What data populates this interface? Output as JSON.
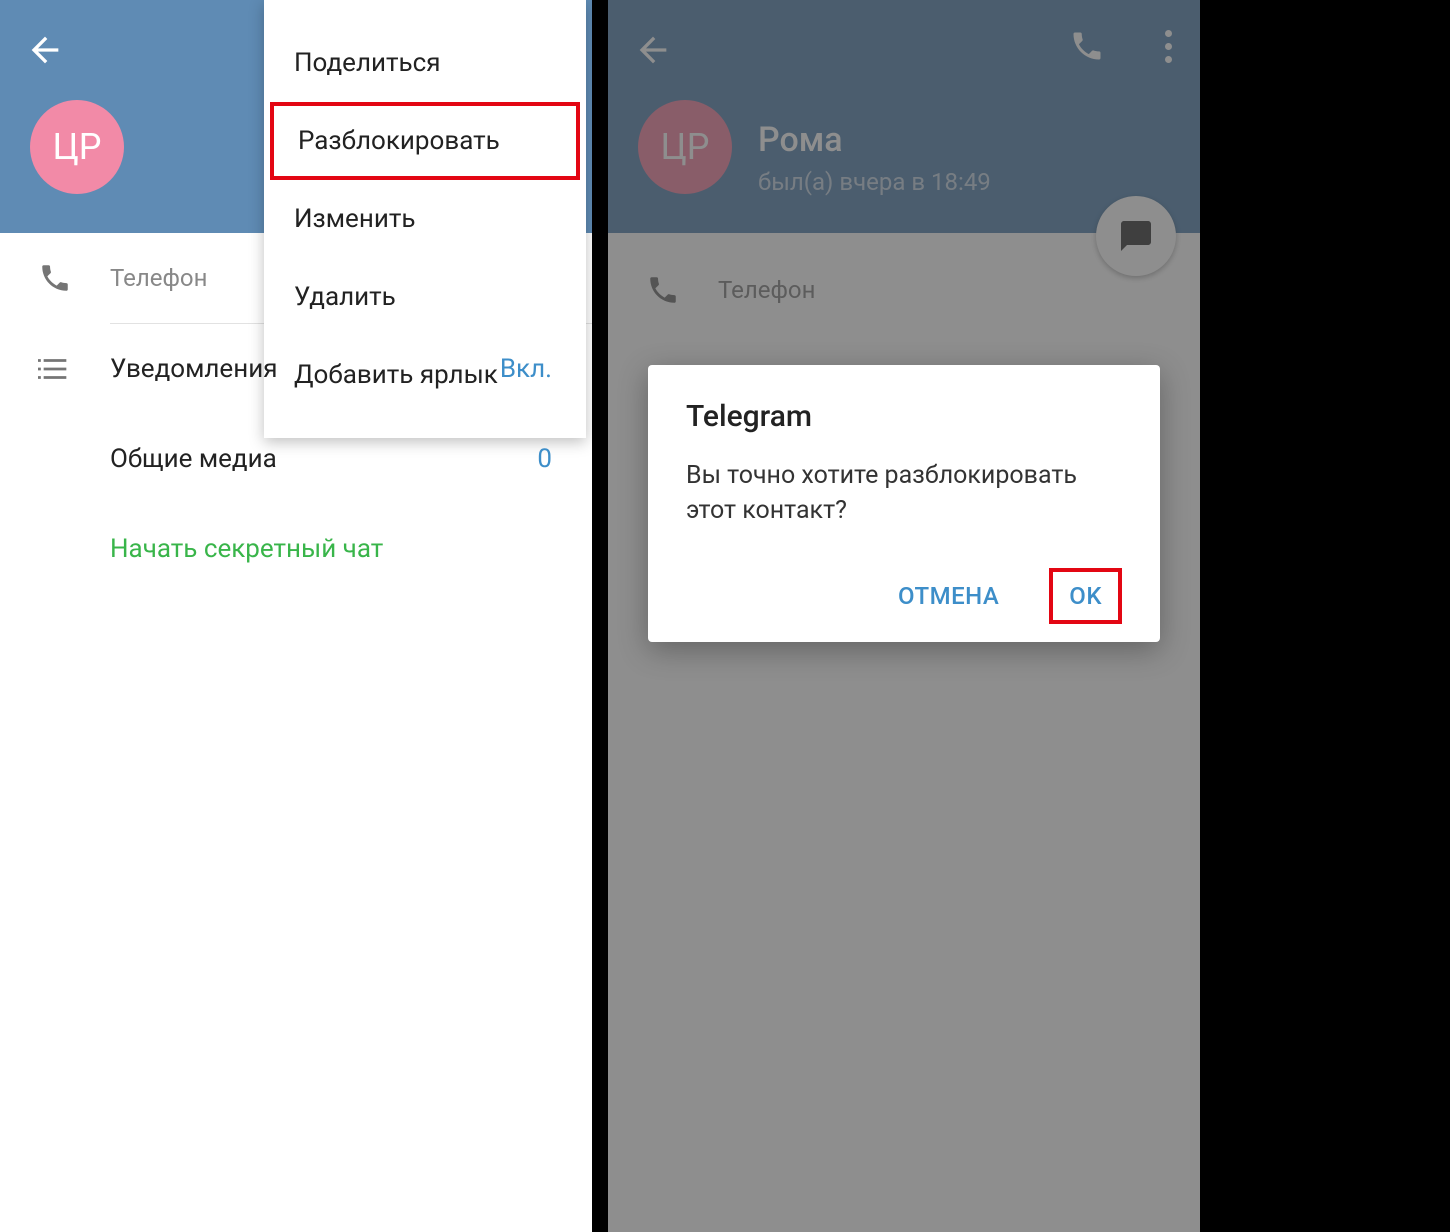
{
  "left": {
    "avatar_initials": "ЦР",
    "menu": {
      "share": "Поделиться",
      "unblock": "Разблокировать",
      "edit": "Изменить",
      "delete": "Удалить",
      "shortcut": "Добавить ярлык"
    },
    "phone_label": "Телефон",
    "notifications_label": "Уведомления",
    "notifications_value": "Вкл.",
    "shared_media_label": "Общие медиа",
    "shared_media_value": "0",
    "secret_chat": "Начать секретный чат"
  },
  "right": {
    "avatar_initials": "ЦР",
    "name": "Рома",
    "status": "был(а) вчера в 18:49",
    "phone_label": "Телефон",
    "dialog": {
      "title": "Telegram",
      "message": "Вы точно хотите разблокировать этот контакт?",
      "cancel": "ОТМЕНА",
      "ok": "OK"
    }
  }
}
